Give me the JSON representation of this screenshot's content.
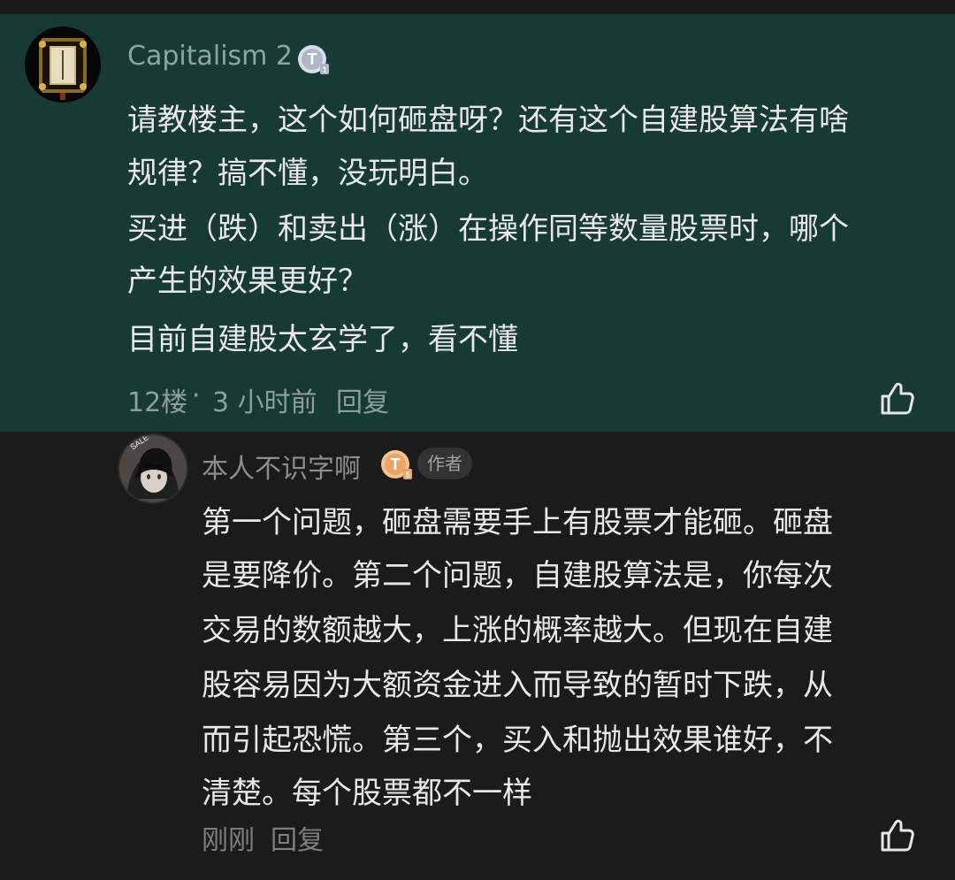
{
  "main_comment": {
    "username": "Capitalism 2",
    "level_badge": "T1",
    "lines": [
      "请教楼主，这个如何砸盘呀？还有这个自建股算法有啥",
      "规律？搞不懂，没玩明白。",
      "买进（跌）和卖出（涨）在操作同等数量股票时，哪个",
      "产生的效果更好？",
      "目前自建股太玄学了，看不懂"
    ],
    "floor": "12楼",
    "separator": "·",
    "time": "3 小时前",
    "reply_label": "回复",
    "like_icon": "thumbs-up-outline-icon"
  },
  "reply": {
    "username": "本人不识字啊",
    "level_badge": "T5",
    "author_label": "作者",
    "lines": [
      "第一个问题，砸盘需要手上有股票才能砸。砸盘",
      "是要降价。第二个问题，自建股算法是，你每次",
      "交易的数额越大，上涨的概率越大。但现在自建",
      "股容易因为大额资金进入而导致的暂时下跌，从",
      "而引起恐慌。第三个，买入和抛出效果谁好，不",
      "清楚。每个股票都不一样"
    ],
    "time": "刚刚",
    "reply_label": "回复",
    "like_icon": "thumbs-up-outline-icon"
  },
  "colors": {
    "main_bg": "#173a34",
    "reply_bg": "#1b1b1b",
    "text": "#e8e8e8",
    "muted": "#8d8d8d"
  }
}
